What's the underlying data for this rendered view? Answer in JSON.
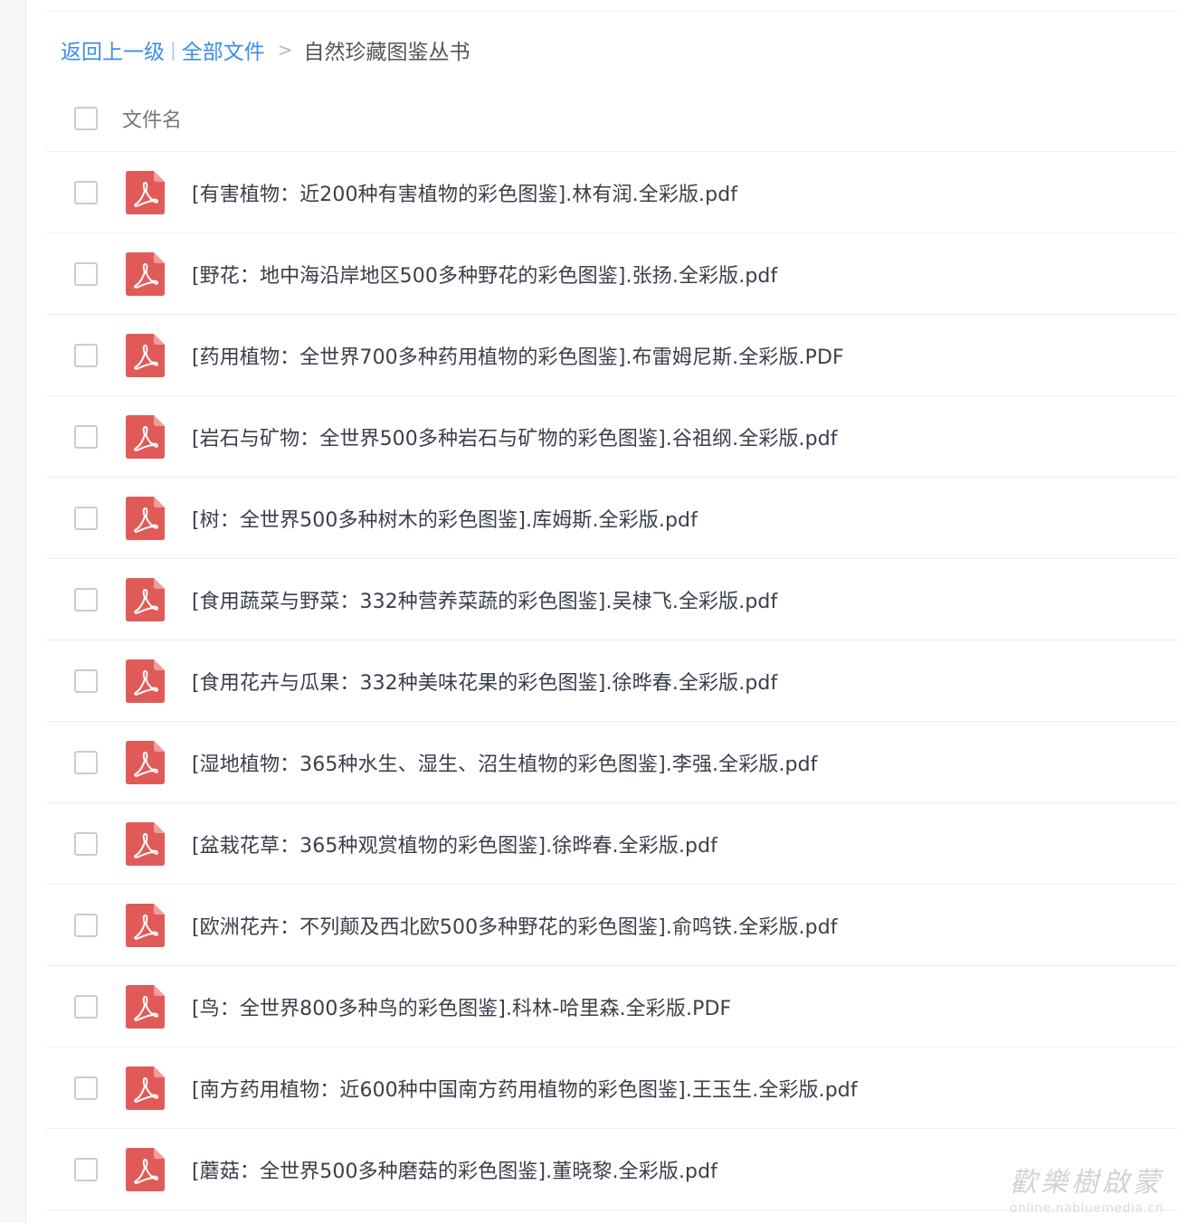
{
  "breadcrumb": {
    "back_label": "返回上一级",
    "separator": "|",
    "root_label": "全部文件",
    "arrow": ">",
    "current_label": "自然珍藏图鉴丛书"
  },
  "list_header": {
    "column_label": "文件名"
  },
  "files": [
    {
      "name": "[有害植物：近200种有害植物的彩色图鉴].林有润.全彩版.pdf",
      "type": "pdf"
    },
    {
      "name": "[野花：地中海沿岸地区500多种野花的彩色图鉴].张扬.全彩版.pdf",
      "type": "pdf"
    },
    {
      "name": "[药用植物：全世界700多种药用植物的彩色图鉴].布雷姆尼斯.全彩版.PDF",
      "type": "pdf"
    },
    {
      "name": "[岩石与矿物：全世界500多种岩石与矿物的彩色图鉴].谷祖纲.全彩版.pdf",
      "type": "pdf"
    },
    {
      "name": "[树：全世界500多种树木的彩色图鉴].库姆斯.全彩版.pdf",
      "type": "pdf"
    },
    {
      "name": "[食用蔬菜与野菜：332种营养菜蔬的彩色图鉴].吴棣飞.全彩版.pdf",
      "type": "pdf"
    },
    {
      "name": "[食用花卉与瓜果：332种美味花果的彩色图鉴].徐晔春.全彩版.pdf",
      "type": "pdf"
    },
    {
      "name": "[湿地植物：365种水生、湿生、沼生植物的彩色图鉴].李强.全彩版.pdf",
      "type": "pdf"
    },
    {
      "name": "[盆栽花草：365种观赏植物的彩色图鉴].徐晔春.全彩版.pdf",
      "type": "pdf"
    },
    {
      "name": "[欧洲花卉：不列颠及西北欧500多种野花的彩色图鉴].俞鸣铁.全彩版.pdf",
      "type": "pdf"
    },
    {
      "name": "[鸟：全世界800多种鸟的彩色图鉴].科林-哈里森.全彩版.PDF",
      "type": "pdf"
    },
    {
      "name": "[南方药用植物：近600种中国南方药用植物的彩色图鉴].王玉生.全彩版.pdf",
      "type": "pdf"
    },
    {
      "name": "[蘑菇：全世界500多种磨菇的彩色图鉴].董晓黎.全彩版.pdf",
      "type": "pdf"
    }
  ],
  "watermark": {
    "title": "歡樂樹啟蒙",
    "url": "online.nabluemedia.cn"
  },
  "colors": {
    "link": "#3b8ee8",
    "pdf_icon": "#e05b58",
    "divider": "#eceef1"
  }
}
